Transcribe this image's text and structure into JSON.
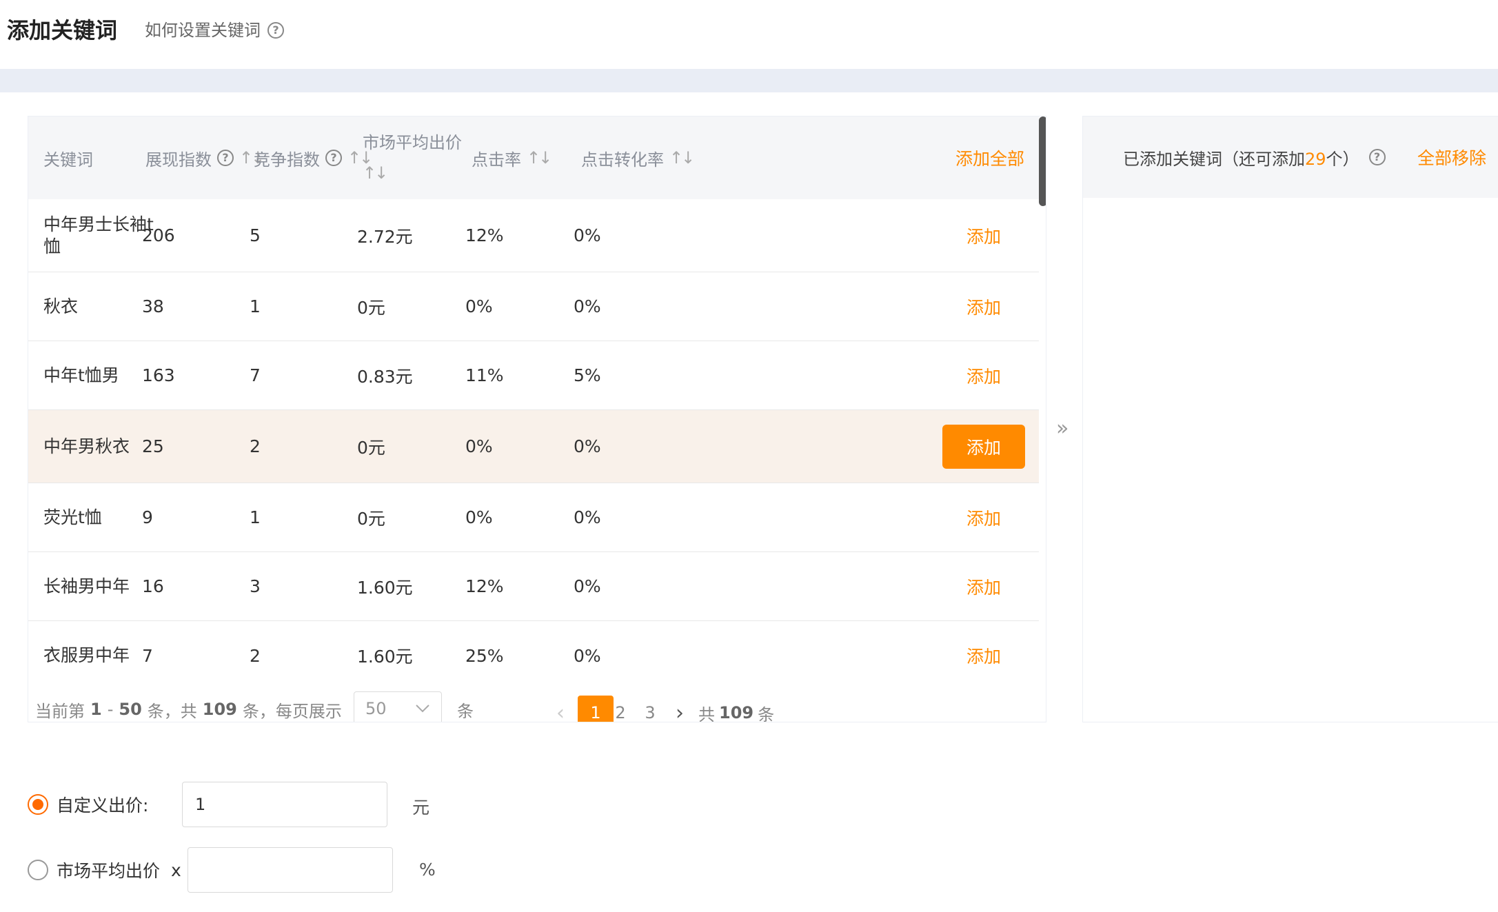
{
  "header": {
    "title": "添加关键词",
    "help_text": "如何设置关键词",
    "help_icon": "?"
  },
  "table": {
    "columns": {
      "keyword": "关键词",
      "impression": "展现指数",
      "competition": "竞争指数",
      "avg_bid_line1": "市场平均出价",
      "ctr": "点击率",
      "cvr": "点击转化率",
      "sort_icon": "↑↓",
      "add_all": "添加全部"
    },
    "add_label": "添加",
    "rows": [
      {
        "keyword": "中年男士长袖t恤",
        "impression": "206",
        "competition": "5",
        "avg_bid": "2.72元",
        "ctr": "12%",
        "cvr": "0%"
      },
      {
        "keyword": "秋衣",
        "impression": "38",
        "competition": "1",
        "avg_bid": "0元",
        "ctr": "0%",
        "cvr": "0%"
      },
      {
        "keyword": "中年t恤男",
        "impression": "163",
        "competition": "7",
        "avg_bid": "0.83元",
        "ctr": "11%",
        "cvr": "5%"
      },
      {
        "keyword": "中年男秋衣",
        "impression": "25",
        "competition": "2",
        "avg_bid": "0元",
        "ctr": "0%",
        "cvr": "0%"
      },
      {
        "keyword": "荧光t恤",
        "impression": "9",
        "competition": "1",
        "avg_bid": "0元",
        "ctr": "0%",
        "cvr": "0%"
      },
      {
        "keyword": "长袖男中年",
        "impression": "16",
        "competition": "3",
        "avg_bid": "1.60元",
        "ctr": "12%",
        "cvr": "0%"
      },
      {
        "keyword": "衣服男中年",
        "impression": "7",
        "competition": "2",
        "avg_bid": "1.60元",
        "ctr": "25%",
        "cvr": "0%"
      }
    ]
  },
  "pagination": {
    "info_prefix": "当前第",
    "range_start": "1",
    "range_sep": "-",
    "range_end": "50",
    "info_mid": "条，共",
    "total": "109",
    "info_suffix": "条，每页展示",
    "page_size": "50",
    "size_unit": "条",
    "pages": [
      "1",
      "2",
      "3"
    ],
    "prev_icon": "‹",
    "next_icon": "›",
    "total_prefix": "共",
    "total_suffix": "条"
  },
  "transfer": {
    "arrow": "»"
  },
  "selected": {
    "title_prefix": "已添加关键词（还可添加",
    "remaining": "29",
    "title_suffix": "个）",
    "remove_all": "全部移除"
  },
  "bid": {
    "custom_label": "自定义出价:",
    "custom_value": "1",
    "custom_unit": "元",
    "market_label": "市场平均出价",
    "market_multiplier": "x",
    "market_value": "",
    "market_unit": "%"
  },
  "colors": {
    "accent": "#ff8a00",
    "row_highlight": "#f9f1ea",
    "header_bg": "#f5f6f8"
  }
}
